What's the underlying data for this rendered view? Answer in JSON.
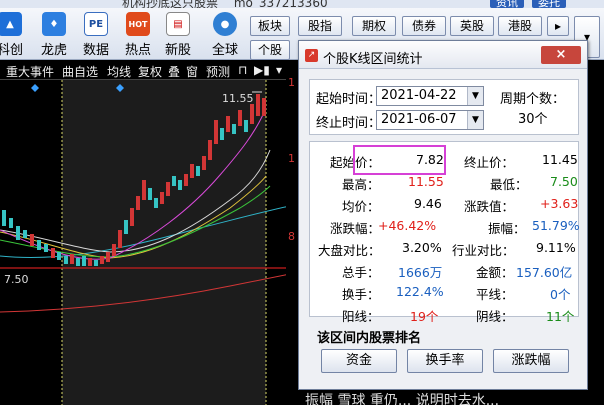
{
  "topbar": {
    "title_fragment": "机构抄底这只股票",
    "user_fragment": "mo_337213360",
    "btn1": "资讯",
    "btn2": "委托"
  },
  "toolbar": {
    "items": [
      {
        "label": "科创"
      },
      {
        "label": "龙虎"
      },
      {
        "label": "数据",
        "icon_text": "PE"
      },
      {
        "label": "热点",
        "icon_text": "HOT"
      },
      {
        "label": "新股"
      },
      {
        "label": "全球"
      }
    ],
    "tabs_row1": [
      "板块",
      "股指",
      "期权",
      "债券",
      "英股",
      "港股"
    ],
    "tabs_row2": [
      "个股"
    ]
  },
  "chart_toolbar": [
    "重大事件",
    "曲自选",
    "均线",
    "复权",
    "叠",
    "窗",
    "预测"
  ],
  "chart": {
    "price_high_label": "11.55",
    "price_low_label": "7.50",
    "axis_labels": [
      "1",
      "8"
    ]
  },
  "dialog": {
    "title": "个股K线区间统计",
    "close_label": "×",
    "start_label": "起始时间：",
    "start_value": "2021-04-22",
    "end_label": "终止时间：",
    "end_value": "2021-06-07",
    "period_label": "周期个数：",
    "period_value": "30个",
    "stats": {
      "start_price_label": "起始价：",
      "start_price": "7.82",
      "end_price_label": "终止价：",
      "end_price": "11.45",
      "high_label": "最高：",
      "high": "11.55",
      "low_label": "最低：",
      "low": "7.50",
      "avg_label": "均价：",
      "avg": "9.46",
      "change_value_label": "涨跌值：",
      "change_value": "+3.63",
      "change_pct_label": "涨跌幅：",
      "change_pct": "+46.42%",
      "amplitude_label": "振幅：",
      "amplitude": "51.79%",
      "market_cmp_label": "大盘对比：",
      "market_cmp": "3.20%",
      "industry_cmp_label": "行业对比：",
      "industry_cmp": "9.11%",
      "volume_label": "总手：",
      "volume": "1666万",
      "amount_label": "金额：",
      "amount": "157.60亿",
      "turnover_label": "换手：",
      "turnover": "122.4%",
      "flat_label": "平线：",
      "flat": "0个",
      "up_label": "阳线：",
      "up": "19个",
      "down_label": "阴线：",
      "down": "11个"
    },
    "rank_title": "该区间内股票排名",
    "buttons": [
      "资金",
      "换手率",
      "涨跌幅"
    ]
  },
  "bottom_fragment": "振幅 雪球 重仍... 说明时去水..."
}
